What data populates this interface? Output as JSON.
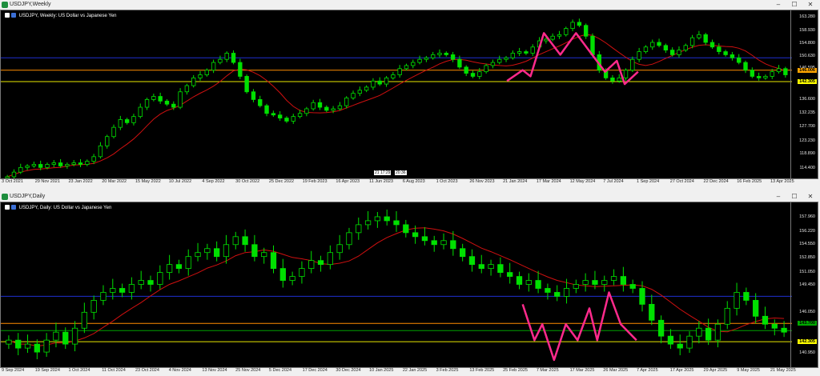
{
  "windows": [
    {
      "title": "USDJPY,Weekly",
      "symbol_line": "USDJPY, Weekly:  US Dollar vs Japanese Yen",
      "controls": {
        "minimize": "–",
        "maximize": "☐",
        "close": "✕"
      },
      "y_ticks": [
        "163.280",
        "158.930",
        "154.800",
        "150.630",
        "146.595",
        "142.300",
        "136.600",
        "132.235",
        "127.700",
        "123.230",
        "118.890",
        "114.400"
      ],
      "tags": [
        {
          "text": "146.006",
          "bg": "#ffa500",
          "fg": "#000"
        },
        {
          "text": "142.305",
          "bg": "#ffff00",
          "fg": "#000"
        }
      ],
      "x_ticks": [
        "3 Oct 2021",
        "29 Nov 2021",
        "23 Jan 2022",
        "20 Mar 2022",
        "15 May 2022",
        "10 Jul 2022",
        "4 Sep 2022",
        "30 Oct 2022",
        "25 Dec 2022",
        "19 Feb 2023",
        "16 Apr 2023",
        "11 Jun 2023",
        "6 Aug 2023",
        "1 Oct 2023",
        "26 Nov 2023",
        "21 Jan 2024",
        "17 Mar 2024",
        "12 May 2024",
        "7 Jul 2024",
        "1 Sep 2024",
        "27 Oct 2024",
        "22 Dec 2024",
        "16 Feb 2025",
        "13 Apr 2025"
      ],
      "crosshair_labels": [
        "21 17:29",
        "20:36"
      ]
    },
    {
      "title": "USDJPY,Daily",
      "symbol_line": "USDJPY, Daily:  US Dollar vs Japanese Yen",
      "controls": {
        "minimize": "–",
        "maximize": "☐",
        "close": "✕"
      },
      "y_ticks": [
        "157.960",
        "156.220",
        "154.550",
        "152.850",
        "151.050",
        "149.450",
        "146.050",
        "142.305",
        "140.950"
      ],
      "tags": [
        {
          "text": "144.333",
          "bg": "#ffa500",
          "fg": "#000"
        },
        {
          "text": "143.700",
          "bg": "#00aa00",
          "fg": "#000"
        },
        {
          "text": "142.305",
          "bg": "#ffff00",
          "fg": "#000"
        }
      ],
      "x_ticks": [
        "9 Sep 2024",
        "19 Sep 2024",
        "1 Oct 2024",
        "11 Oct 2024",
        "23 Oct 2024",
        "4 Nov 2024",
        "13 Nov 2024",
        "25 Nov 2024",
        "5 Dec 2024",
        "17 Dec 2024",
        "30 Dec 2024",
        "10 Jan 2025",
        "22 Jan 2025",
        "3 Feb 2025",
        "13 Feb 2025",
        "25 Feb 2025",
        "7 Mar 2025",
        "17 Mar 2025",
        "26 Mar 2025",
        "7 Apr 2025",
        "17 Apr 2025",
        "29 Apr 2025",
        "9 May 2025",
        "21 May 2025"
      ]
    }
  ],
  "colors": {
    "candle": "#00e000",
    "ma": "#d01010",
    "pattern": "#ff2a8c",
    "blue_line": "#1f2fd0",
    "yellow_line": "#e8e800",
    "orange_line": "#ff8c00",
    "green_line": "#00a000"
  },
  "chart_data": [
    {
      "type": "candlestick",
      "title": "USDJPY, Weekly: US Dollar vs Japanese Yen",
      "ylim": [
        112.0,
        163.28
      ],
      "y_ticks": [
        163.28,
        158.93,
        154.8,
        150.63,
        146.595,
        142.3,
        136.6,
        132.235,
        127.7,
        123.23,
        118.89,
        114.4
      ],
      "x_ticks": [
        "3 Oct 2021",
        "29 Nov 2021",
        "23 Jan 2022",
        "20 Mar 2022",
        "15 May 2022",
        "10 Jul 2022",
        "4 Sep 2022",
        "30 Oct 2022",
        "25 Dec 2022",
        "19 Feb 2023",
        "16 Apr 2023",
        "11 Jun 2023",
        "6 Aug 2023",
        "1 Oct 2023",
        "26 Nov 2023",
        "21 Jan 2024",
        "17 Mar 2024",
        "12 May 2024",
        "7 Jul 2024",
        "1 Sep 2024",
        "27 Oct 2024",
        "22 Dec 2024",
        "16 Feb 2025",
        "13 Apr 2025"
      ],
      "close_path": [
        111.5,
        113.0,
        114.5,
        115.0,
        115.5,
        114.5,
        115.5,
        116.0,
        115.0,
        115.5,
        116.0,
        115.5,
        116.5,
        118.0,
        121.5,
        124.5,
        127.5,
        130.0,
        129.0,
        131.0,
        134.0,
        136.5,
        137.5,
        136.0,
        135.0,
        134.0,
        139.0,
        141.0,
        143.5,
        144.5,
        146.0,
        148.5,
        149.5,
        151.5,
        148.5,
        144.0,
        139.0,
        136.5,
        134.5,
        132.0,
        131.5,
        130.5,
        129.5,
        131.0,
        132.0,
        133.5,
        135.5,
        134.0,
        133.0,
        133.5,
        134.5,
        137.0,
        138.5,
        139.5,
        140.5,
        142.5,
        141.5,
        143.5,
        144.5,
        146.5,
        147.5,
        148.5,
        149.5,
        150.0,
        151.0,
        151.5,
        151.0,
        149.5,
        147.0,
        145.0,
        144.0,
        145.5,
        147.5,
        148.5,
        149.5,
        150.0,
        151.5,
        152.0,
        151.5,
        153.5,
        155.5,
        156.0,
        157.0,
        157.5,
        159.5,
        161.5,
        160.5,
        157.0,
        151.0,
        146.0,
        143.5,
        142.5,
        143.5,
        146.0,
        149.5,
        152.0,
        153.5,
        155.0,
        154.0,
        152.5,
        151.0,
        152.5,
        154.0,
        156.5,
        157.5,
        155.0,
        153.5,
        152.0,
        151.0,
        150.0,
        148.5,
        146.0,
        144.0,
        143.5,
        144.0,
        145.5,
        146.5,
        144.5
      ],
      "ma_color": "#d01010",
      "horizontal_lines": [
        {
          "value": 150.0,
          "color": "#1f2fd0"
        },
        {
          "value": 146.006,
          "color": "#ff8c00"
        },
        {
          "value": 142.305,
          "color": "#e8e800"
        }
      ],
      "pattern": {
        "name": "zigzag",
        "color": "#ff2a8c",
        "points": [
          [
            0.645,
            142.5
          ],
          [
            0.665,
            146.0
          ],
          [
            0.675,
            144.0
          ],
          [
            0.692,
            158.0
          ],
          [
            0.713,
            151.0
          ],
          [
            0.733,
            158.0
          ],
          [
            0.752,
            151.5
          ],
          [
            0.77,
            145.5
          ],
          [
            0.785,
            149.0
          ],
          [
            0.795,
            141.5
          ],
          [
            0.812,
            145.5
          ]
        ]
      }
    },
    {
      "type": "candlestick",
      "title": "USDJPY, Daily: US Dollar vs Japanese Yen",
      "ylim": [
        139.5,
        159.0
      ],
      "y_ticks": [
        157.96,
        156.22,
        154.55,
        152.85,
        151.05,
        149.45,
        146.05,
        142.305,
        140.95
      ],
      "x_ticks": [
        "9 Sep 2024",
        "19 Sep 2024",
        "1 Oct 2024",
        "11 Oct 2024",
        "23 Oct 2024",
        "4 Nov 2024",
        "13 Nov 2024",
        "25 Nov 2024",
        "5 Dec 2024",
        "17 Dec 2024",
        "30 Dec 2024",
        "10 Jan 2025",
        "22 Jan 2025",
        "3 Feb 2025",
        "13 Feb 2025",
        "25 Feb 2025",
        "7 Mar 2025",
        "17 Mar 2025",
        "26 Mar 2025",
        "7 Apr 2025",
        "17 Apr 2025",
        "29 Apr 2025",
        "9 May 2025",
        "21 May 2025"
      ],
      "close_path": [
        142.5,
        141.5,
        142.0,
        141.0,
        142.5,
        143.5,
        142.0,
        144.0,
        146.0,
        147.5,
        148.5,
        149.0,
        148.5,
        149.5,
        150.0,
        149.5,
        151.0,
        152.0,
        151.5,
        153.0,
        153.5,
        154.0,
        153.0,
        154.5,
        155.5,
        154.5,
        153.0,
        153.5,
        151.5,
        150.0,
        150.5,
        151.5,
        152.5,
        152.0,
        153.5,
        154.5,
        156.0,
        157.0,
        157.5,
        158.0,
        157.5,
        157.0,
        156.0,
        155.5,
        155.0,
        154.5,
        155.0,
        154.0,
        153.0,
        152.0,
        151.5,
        152.0,
        151.0,
        150.5,
        149.5,
        150.0,
        149.0,
        148.5,
        148.0,
        149.0,
        149.5,
        150.0,
        149.5,
        150.0,
        150.5,
        149.5,
        149.0,
        147.0,
        145.0,
        143.0,
        142.0,
        141.5,
        143.0,
        144.0,
        142.5,
        144.5,
        146.5,
        148.5,
        147.5,
        145.5,
        144.5,
        144.0,
        143.5
      ],
      "ma_color": "#d01010",
      "horizontal_lines": [
        {
          "value": 148.0,
          "color": "#1f2fd0"
        },
        {
          "value": 144.6,
          "color": "#ff8c00"
        },
        {
          "value": 143.7,
          "color": "#00a000"
        },
        {
          "value": 142.305,
          "color": "#e8e800"
        }
      ],
      "pattern": {
        "name": "zigzag",
        "color": "#ff2a8c",
        "points": [
          [
            0.665,
            147.0
          ],
          [
            0.68,
            142.5
          ],
          [
            0.69,
            144.5
          ],
          [
            0.705,
            140.0
          ],
          [
            0.72,
            144.5
          ],
          [
            0.735,
            142.5
          ],
          [
            0.75,
            146.5
          ],
          [
            0.76,
            142.5
          ],
          [
            0.775,
            148.5
          ],
          [
            0.79,
            144.5
          ],
          [
            0.81,
            142.5
          ]
        ]
      }
    }
  ]
}
